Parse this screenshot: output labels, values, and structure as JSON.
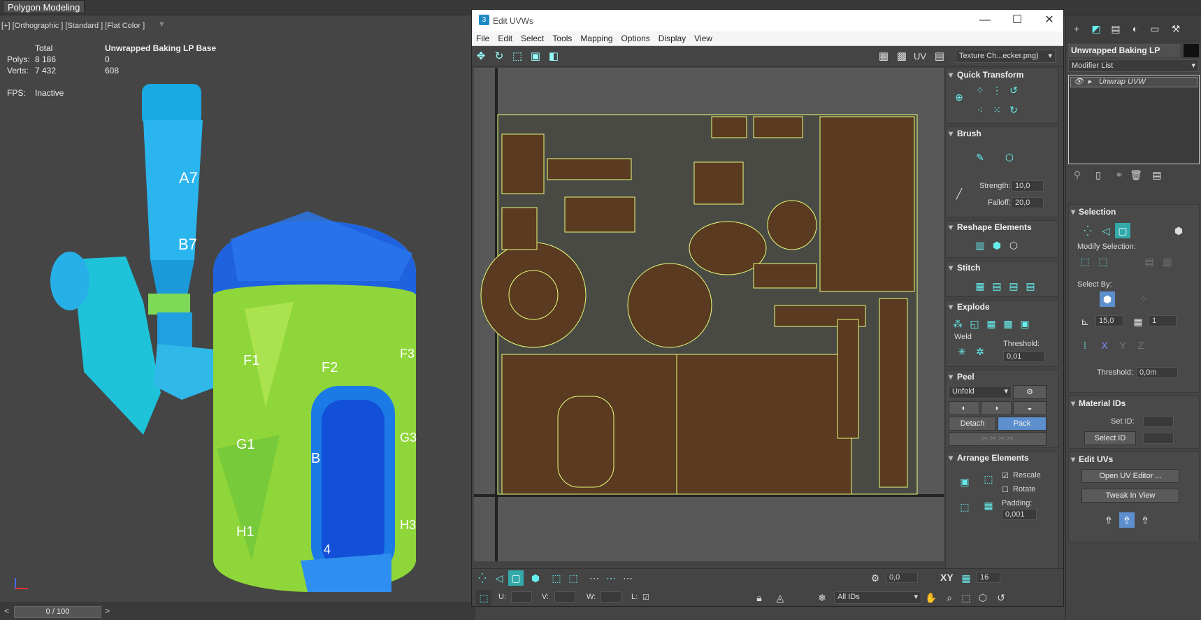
{
  "app": {
    "ribbon_tab": "Polygon Modeling"
  },
  "viewport": {
    "label": "[+] [Orthographic ] [Standard ] [Flat Color ]",
    "stats": {
      "col_total": "Total",
      "col_object": "Unwrapped Baking LP Base",
      "polys_label": "Polys:",
      "polys_total": "8 186",
      "polys_object": "0",
      "verts_label": "Verts:",
      "verts_total": "7 432",
      "verts_object": "608",
      "fps_label": "FPS:",
      "fps_value": "Inactive"
    },
    "tiles": [
      "A7",
      "B7",
      "F1",
      "F2",
      "F3",
      "G1",
      "G3",
      "H1",
      "H3",
      "B",
      "4"
    ]
  },
  "timeline": {
    "frame": "0 / 100",
    "prev": "<",
    "next": ">"
  },
  "uv_editor": {
    "title": "Edit UVWs",
    "menu": [
      "File",
      "Edit",
      "Select",
      "Tools",
      "Mapping",
      "Options",
      "Display",
      "View"
    ],
    "uv_label": "UV",
    "texture": "Texture Ch...ecker.png)",
    "quick_transform": "Quick Transform",
    "brush": {
      "title": "Brush",
      "strength_label": "Strength:",
      "strength": "10,0",
      "falloff_label": "Falloff:",
      "falloff": "20,0"
    },
    "reshape": "Reshape Elements",
    "stitch": "Stitch",
    "explode": {
      "title": "Explode",
      "weld_label": "Weld",
      "threshold_label": "Threshold:",
      "threshold": "0,01"
    },
    "peel": {
      "title": "Peel",
      "mode": "Unfold",
      "detach": "Detach",
      "pack": "Pack"
    },
    "arrange": {
      "title": "Arrange Elements",
      "rescale": "Rescale",
      "rotate": "Rotate",
      "padding_label": "Padding:",
      "padding": "0,001"
    },
    "bottom": {
      "u_label": "U:",
      "v_label": "V:",
      "w_label": "W:",
      "l_label": "L:",
      "ids": "All IDs",
      "angle": "0,0",
      "xy": "XY",
      "grid": "16"
    }
  },
  "command_panel": {
    "object_name": "Unwrapped Baking LP Base",
    "modifier_list": "Modifier List",
    "modifier": "Unwrap UVW",
    "selection": {
      "title": "Selection",
      "modify_label": "Modify Selection:",
      "select_by_label": "Select By:",
      "angle": "15,0",
      "count": "1",
      "threshold_label": "Threshold:",
      "threshold": "0,0m"
    },
    "material_ids": {
      "title": "Material IDs",
      "set_id_label": "Set ID:",
      "select_id": "Select ID"
    },
    "edit_uvs": {
      "title": "Edit UVs",
      "open_editor": "Open UV Editor ...",
      "tweak": "Tweak In View"
    }
  }
}
